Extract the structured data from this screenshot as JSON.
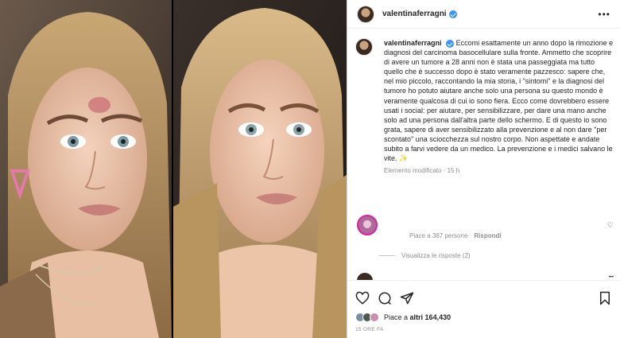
{
  "header": {
    "username": "valentinaferragni",
    "more_icon": "more-horizontal-icon"
  },
  "caption": {
    "username": "valentinaferragni",
    "text": "Eccomi esattamente un anno dopo la rimozione e diagnosi del carcinoma basocellulare sulla fronte. Ammetto che scoprire di avere un tumore a 28 anni non è stata una passeggiata ma tutto quello che è successo dopo è stato veramente pazzesco: sapere che, nel mio piccolo, raccontando la mia storia, i \"sintomi\" e la diagnosi del tumore ho potuto aiutare anche solo una persona su questo mondo è veramente qualcosa di cui io sono fiera. Ecco come dovrebbero essere usati i social: per aiutare, per sensibilizzare, per dare una mano anche solo ad una persona dall'altra parte dello schermo. E di questo io sono grata, sapere di aver sensibilizzato alla prevenzione e al non dare \"per scontato\" una sciocchezza sul nostro corpo. Non aspettate e andate subito a farvi vedere da un medico. La prevenzione e i medici salvano le vite. ✨",
    "edited": "Elemento modificato",
    "time": "15 h"
  },
  "comment": {
    "meta_likes": "Piace a 387 persone",
    "reply_label": "Rispondi",
    "view_replies": "Visualizza le risposte (2)"
  },
  "actions": {
    "icons": [
      "heart-icon",
      "comment-icon",
      "share-icon",
      "bookmark-icon"
    ],
    "likes_prefix": "Piace a",
    "likes_suffix": "altri 164,430",
    "timestamp": "15 ORE FA"
  },
  "colors": {
    "verified": "#3897f0",
    "text": "#262626",
    "muted": "#8e8e8e"
  }
}
